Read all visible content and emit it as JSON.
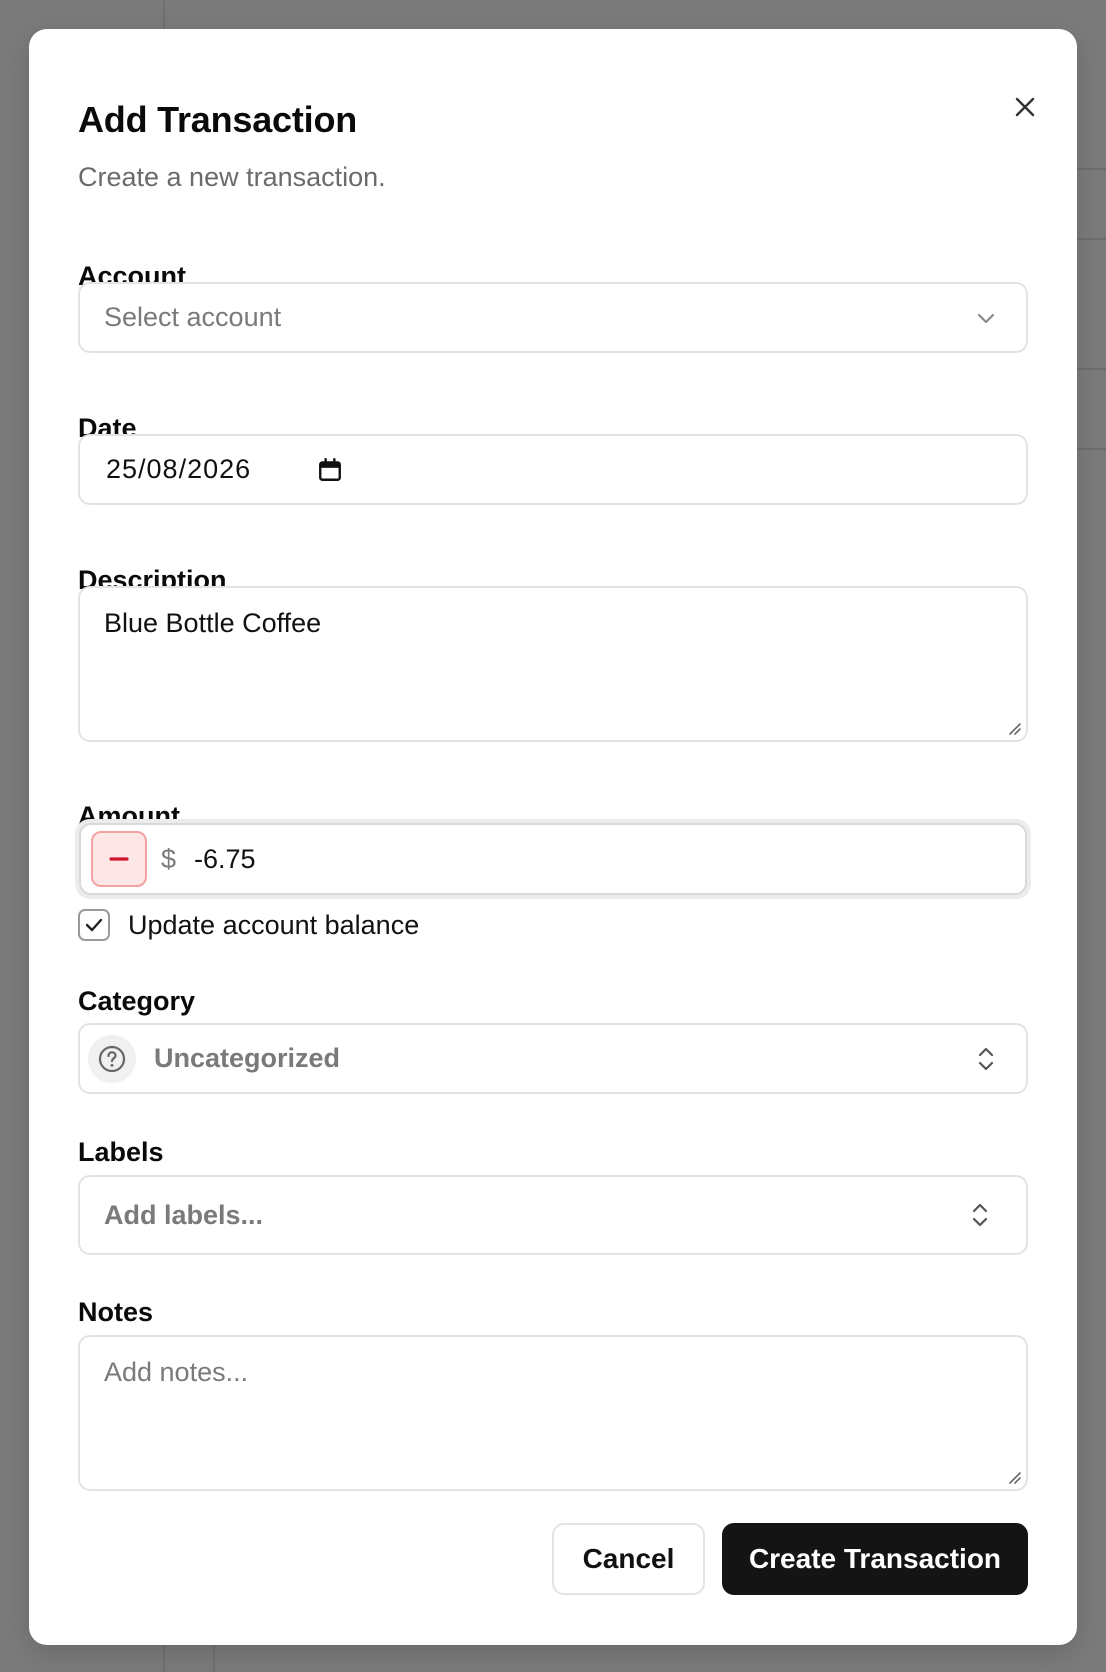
{
  "dialog": {
    "title": "Add Transaction",
    "subtitle": "Create a new transaction."
  },
  "form": {
    "account": {
      "label": "Account",
      "placeholder": "Select account",
      "value": ""
    },
    "date": {
      "label": "Date",
      "value": "25/08/2026"
    },
    "description": {
      "label": "Description",
      "value": "Blue Bottle Coffee"
    },
    "amount": {
      "label": "Amount",
      "currency_symbol": "$",
      "value": "-6.75",
      "sign": "negative"
    },
    "update_balance": {
      "label": "Update account balance",
      "checked": true
    },
    "category": {
      "label": "Category",
      "value": "Uncategorized"
    },
    "labels": {
      "label": "Labels",
      "placeholder": "Add labels..."
    },
    "notes": {
      "label": "Notes",
      "placeholder": "Add notes..."
    }
  },
  "actions": {
    "cancel_label": "Cancel",
    "submit_label": "Create Transaction"
  },
  "colors": {
    "overlay": "#7b7b7b",
    "primary_button": "#141414",
    "negative_accent": "#d0142c",
    "negative_bg": "#fde6e6"
  },
  "icons": {
    "close": "close-icon",
    "account_dropdown": "chevron-down-icon",
    "date_picker": "calendar-icon",
    "amount_sign": "minus-icon",
    "checkbox": "check-icon",
    "category": "question-circle-icon",
    "selector": "chevron-up-down-icon",
    "resize": "resize-handle-icon"
  }
}
